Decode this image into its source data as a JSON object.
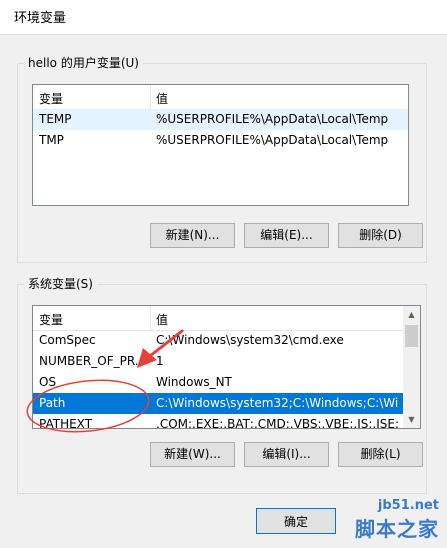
{
  "window": {
    "title": "环境变量"
  },
  "user_vars": {
    "legend": "hello 的用户变量(U)",
    "col_var": "变量",
    "col_val": "值",
    "rows": [
      {
        "name": "TEMP",
        "value": "%USERPROFILE%\\AppData\\Local\\Temp"
      },
      {
        "name": "TMP",
        "value": "%USERPROFILE%\\AppData\\Local\\Temp"
      }
    ],
    "new_label": "新建(N)...",
    "edit_label": "编辑(E)...",
    "delete_label": "删除(D)"
  },
  "system_vars": {
    "legend": "系统变量(S)",
    "col_var": "变量",
    "col_val": "值",
    "rows": [
      {
        "name": "ComSpec",
        "value": "C:\\Windows\\system32\\cmd.exe"
      },
      {
        "name": "NUMBER_OF_PR...",
        "value": "1"
      },
      {
        "name": "OS",
        "value": "Windows_NT"
      },
      {
        "name": "Path",
        "value": "C:\\Windows\\system32;C:\\Windows;C:\\Wi..."
      },
      {
        "name": "PATHEXT",
        "value": ".COM;.EXE;.BAT;.CMD;.VBS;.VBE;.JS;.JSE;..."
      }
    ],
    "new_label": "新建(W)...",
    "edit_label": "编辑(I)...",
    "delete_label": "删除(L)"
  },
  "ok_label": "确定",
  "watermark": {
    "site": "jb51.net",
    "brand": "脚本之家"
  },
  "colors": {
    "selection": "#0078d7",
    "annotation": "#e8403a"
  }
}
